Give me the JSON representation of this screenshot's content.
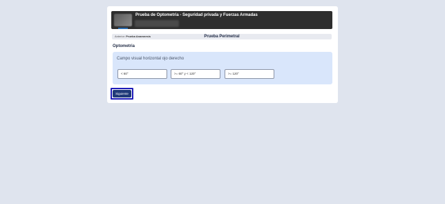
{
  "header": {
    "title": "Prueba de Optometria - Seguridad privada y Fuerzas Armadas"
  },
  "nav": {
    "prev_label": "Anterior:",
    "prev_name": "Prueba Anamnesis",
    "current": "Prueba Perimetral"
  },
  "section": {
    "title": "Optometria"
  },
  "question": {
    "text": "Campo visual horizontal ojo derecho",
    "options": [
      "< 60°",
      ">= 60° y < 120°",
      ">= 120°"
    ]
  },
  "actions": {
    "next_label": "Siguiente"
  },
  "colors": {
    "background": "#dfe4ee",
    "header_bg": "#2e2e2e",
    "question_bg": "#d9e6fb",
    "button_bg": "#1f3a78",
    "highlight": "#1d1bb8"
  }
}
